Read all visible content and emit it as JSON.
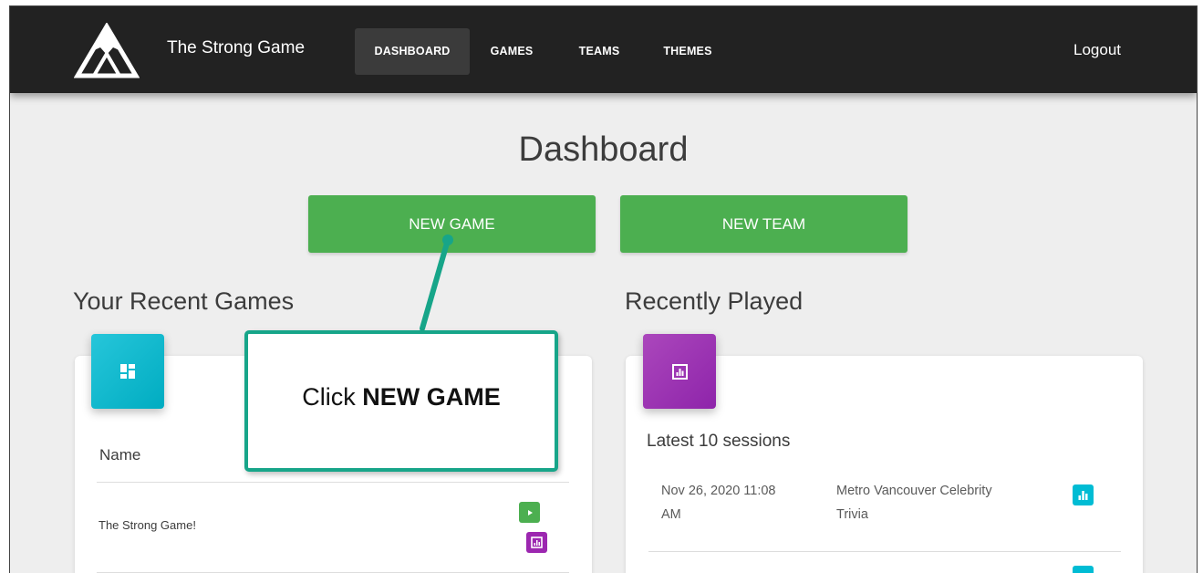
{
  "navbar": {
    "brand": "The Strong Game",
    "items": [
      {
        "label": "DASHBOARD",
        "active": true
      },
      {
        "label": "GAMES",
        "active": false
      },
      {
        "label": "TEAMS",
        "active": false
      },
      {
        "label": "THEMES",
        "active": false
      }
    ],
    "logout": "Logout"
  },
  "page": {
    "title": "Dashboard",
    "new_game_button": "NEW GAME",
    "new_team_button": "NEW TEAM"
  },
  "recent_games": {
    "title": "Your Recent Games",
    "column_header": "Name",
    "rows": [
      {
        "name": "The Strong Game!"
      }
    ]
  },
  "recently_played": {
    "title": "Recently Played",
    "subtitle": "Latest 10 sessions",
    "sessions": [
      {
        "date_line1": "Nov 26, 2020 11:08",
        "date_line2": "AM",
        "name_line1": "Metro Vancouver Celebrity",
        "name_line2": "Trivia"
      }
    ]
  },
  "callout": {
    "prefix": "Click ",
    "emphasis": "NEW GAME"
  },
  "colors": {
    "navbar": "#222222",
    "background": "#eeeeee",
    "primary_green": "#4caf50",
    "cyan": "#00bcd4",
    "purple": "#9c27b0",
    "callout_border": "#17a589"
  },
  "icons": {
    "logo": "mountain-triangle-logo",
    "recent_games_card": "dashboard-icon",
    "recently_played_card": "chart-icon",
    "play": "play-icon",
    "stats": "chart-icon",
    "session_stats": "bar-chart-icon"
  }
}
